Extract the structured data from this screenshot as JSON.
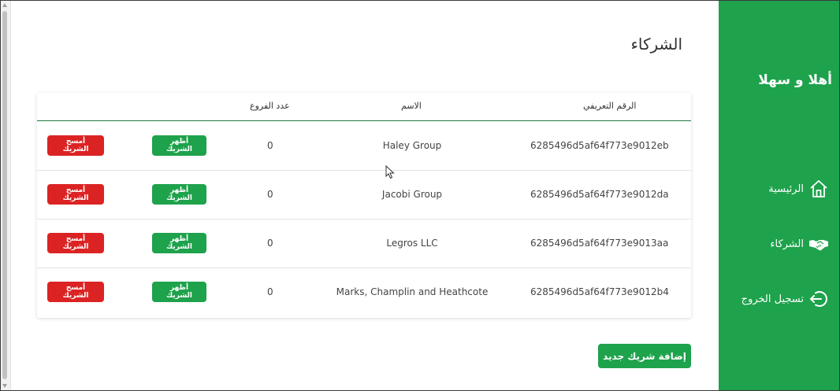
{
  "sidebar": {
    "welcome": "أهلا و سهلا",
    "items": [
      {
        "label": "الرئيسية",
        "icon": "home-icon"
      },
      {
        "label": "الشركاء",
        "icon": "handshake-icon"
      },
      {
        "label": "تسجيل الخروج",
        "icon": "logout-icon"
      }
    ],
    "color": "#1ea24c"
  },
  "main": {
    "title": "الشركاء",
    "table": {
      "headers": {
        "id": "الرقم التعريفي",
        "name": "الاسم",
        "branches": "عدد الفروع"
      },
      "rows": [
        {
          "id": "6285496d5af64f773e9012eb",
          "name": "Haley Group",
          "branches": "0",
          "show_label": "أظهر الشريك",
          "delete_label": "أمسح الشريك"
        },
        {
          "id": "6285496d5af64f773e9012da",
          "name": "Jacobi Group",
          "branches": "0",
          "show_label": "أظهر الشريك",
          "delete_label": "أمسح الشريك"
        },
        {
          "id": "6285496d5af64f773e9013aa",
          "name": "Legros LLC",
          "branches": "0",
          "show_label": "أظهر الشريك",
          "delete_label": "أمسح الشريك"
        },
        {
          "id": "6285496d5af64f773e9012b4",
          "name": "Marks, Champlin and Heathcote",
          "branches": "0",
          "show_label": "أظهر الشريك",
          "delete_label": "أمسح الشريك"
        }
      ]
    },
    "add_button": "إضافة شريك جديد",
    "colors": {
      "primary": "#1ea24c",
      "danger": "#dc2323",
      "header_rule": "#1d7a3f"
    }
  }
}
